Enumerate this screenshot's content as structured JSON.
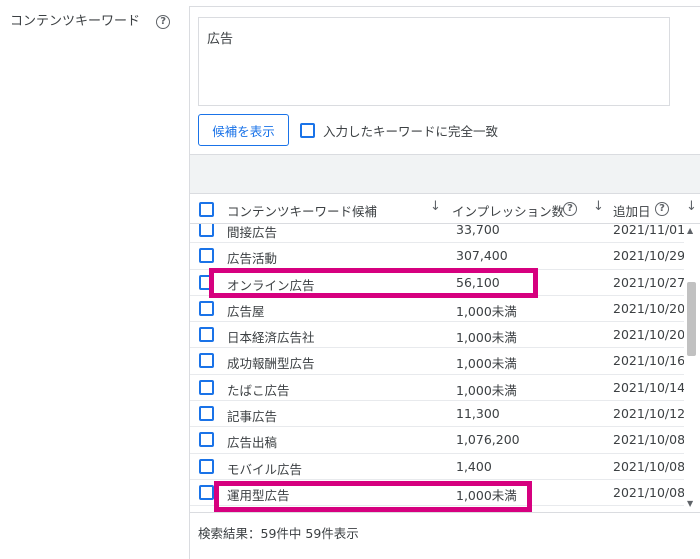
{
  "section": {
    "label": "コンテンツキーワード",
    "help_icon": "?"
  },
  "keyword_input": {
    "value": "広告"
  },
  "show_candidates_button": "候補を表示",
  "exact_match": {
    "label": "入力したキーワードに完全一致",
    "checked": false
  },
  "table": {
    "headers": {
      "keyword": "コンテンツキーワード候補",
      "impressions": "インプレッション数",
      "date_added": "追加日",
      "sort_icon": "↓",
      "help_icon": "?"
    },
    "rows": [
      {
        "keyword": "間接広告",
        "impressions": "33,700",
        "date": "2021/11/01"
      },
      {
        "keyword": "広告活動",
        "impressions": "307,400",
        "date": "2021/10/29"
      },
      {
        "keyword": "オンライン広告",
        "impressions": "56,100",
        "date": "2021/10/27"
      },
      {
        "keyword": "広告屋",
        "impressions": "1,000未満",
        "date": "2021/10/20"
      },
      {
        "keyword": "日本経済広告社",
        "impressions": "1,000未満",
        "date": "2021/10/20"
      },
      {
        "keyword": "成功報酬型広告",
        "impressions": "1,000未満",
        "date": "2021/10/16"
      },
      {
        "keyword": "たばこ広告",
        "impressions": "1,000未満",
        "date": "2021/10/14"
      },
      {
        "keyword": "記事広告",
        "impressions": "11,300",
        "date": "2021/10/12"
      },
      {
        "keyword": "広告出稿",
        "impressions": "1,076,200",
        "date": "2021/10/08"
      },
      {
        "keyword": "モバイル広告",
        "impressions": "1,400",
        "date": "2021/10/08"
      },
      {
        "keyword": "運用型広告",
        "impressions": "1,000未満",
        "date": "2021/10/08"
      }
    ]
  },
  "footer": {
    "result_text": "検索結果：59件中 59件表示"
  },
  "colors": {
    "accent": "#1a73e8",
    "highlight": "#d6007f"
  }
}
